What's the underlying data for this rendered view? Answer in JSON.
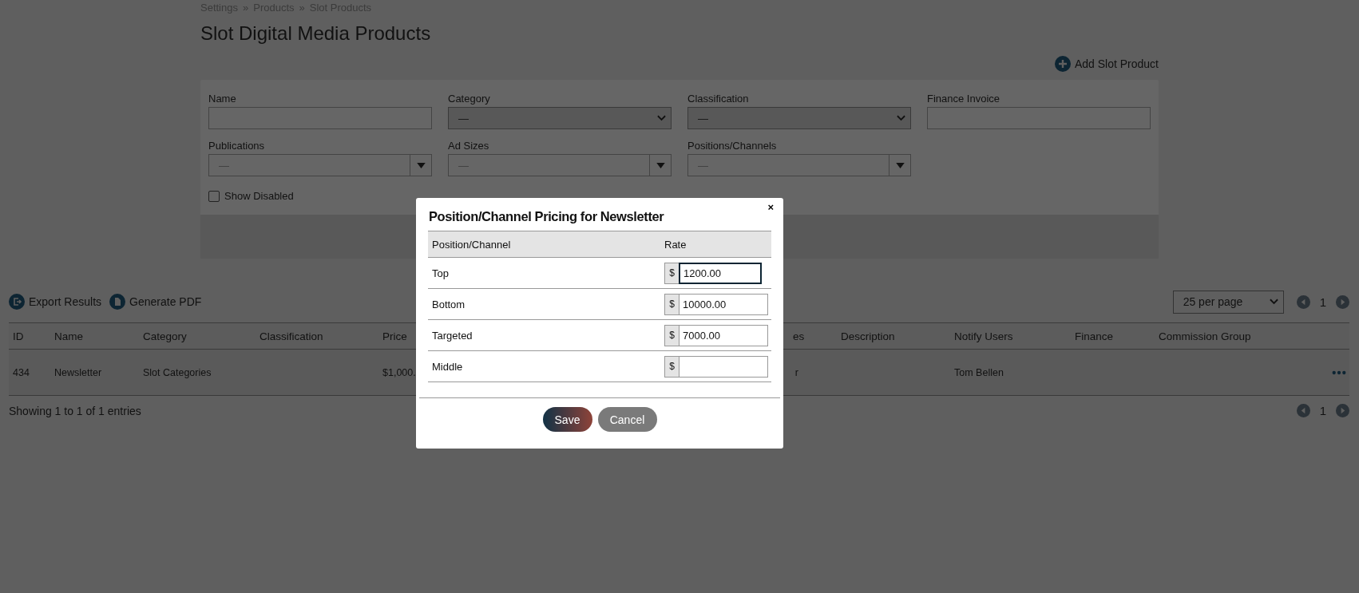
{
  "breadcrumb": {
    "items": [
      "Settings",
      "Products",
      "Slot Products"
    ],
    "separator": "»"
  },
  "title": "Slot Digital Media Products",
  "add_button": {
    "label": "Add Slot Product"
  },
  "filters": [
    {
      "kind": "text",
      "label": "Name"
    },
    {
      "kind": "select",
      "label": "Category",
      "value": "—"
    },
    {
      "kind": "select",
      "label": "Classification",
      "value": "—"
    },
    {
      "kind": "text",
      "label": "Finance Invoice"
    },
    {
      "kind": "multiselect",
      "label": "Publications",
      "placeholder": "—"
    },
    {
      "kind": "multiselect",
      "label": "Ad Sizes",
      "placeholder": "—"
    },
    {
      "kind": "multiselect",
      "label": "Positions/Channels",
      "placeholder": "—"
    },
    {
      "kind": "checkbox",
      "label": "Show Disabled",
      "checked": false
    }
  ],
  "toolbar": {
    "export": "Export Results",
    "pdf": "Generate PDF",
    "per_page": "25 per page",
    "page": "1"
  },
  "table": {
    "columns": [
      "ID",
      "Name",
      "Category",
      "Classification",
      "Price",
      "es",
      "Description",
      "Notify Users",
      "Finance",
      "Commission Group"
    ],
    "rows": [
      [
        "434",
        "Newsletter",
        "Slot Categories",
        "",
        "$1,000.",
        "r",
        "",
        "Tom Bellen",
        "",
        ""
      ]
    ]
  },
  "footer": {
    "info": "Showing 1 to 1 of 1 entries",
    "page": "1"
  },
  "modal": {
    "title": "Position/Channel Pricing for Newsletter",
    "close": "×",
    "columns": [
      "Position/Channel",
      "Rate"
    ],
    "rows": [
      {
        "label": "Top",
        "currency": "$",
        "value": "1200.00",
        "focused": true
      },
      {
        "label": "Bottom",
        "currency": "$",
        "value": "10000.00",
        "focused": false
      },
      {
        "label": "Targeted",
        "currency": "$",
        "value": "7000.00",
        "focused": false
      },
      {
        "label": "Middle",
        "currency": "$",
        "value": "",
        "focused": false
      }
    ],
    "save": "Save",
    "cancel": "Cancel"
  }
}
